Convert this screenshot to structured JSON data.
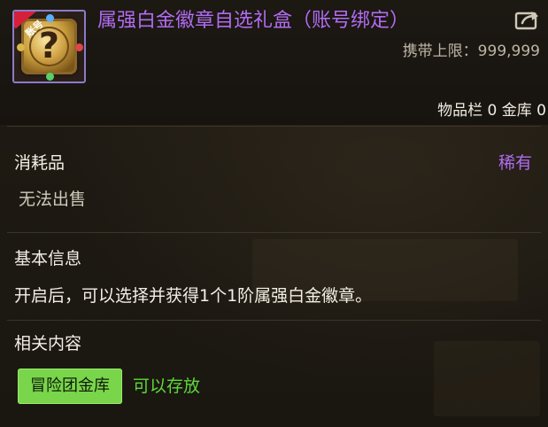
{
  "item": {
    "title": "属强白金徽章自选礼盒（账号绑定）",
    "icon_badge": "账号",
    "icon_symbol": "?",
    "carry_limit": "携带上限：999,999",
    "storage_info": "物品栏 0 金库 0"
  },
  "category": {
    "type_label": "消耗品",
    "rarity_label": "稀有",
    "sell_note": "无法出售"
  },
  "basic_info": {
    "title": "基本信息",
    "description": "开启后，可以选择并获得1个1阶属强白金徽章。"
  },
  "related": {
    "title": "相关内容",
    "tag_label": "冒险团金库",
    "tag_note": "可以存放"
  },
  "icons": {
    "share": "share-icon",
    "item": "mystery-coin-icon"
  },
  "colors": {
    "rarity_purple": "#b26cf2",
    "tag_green": "#79d64a",
    "note_green": "#5ed83a"
  }
}
